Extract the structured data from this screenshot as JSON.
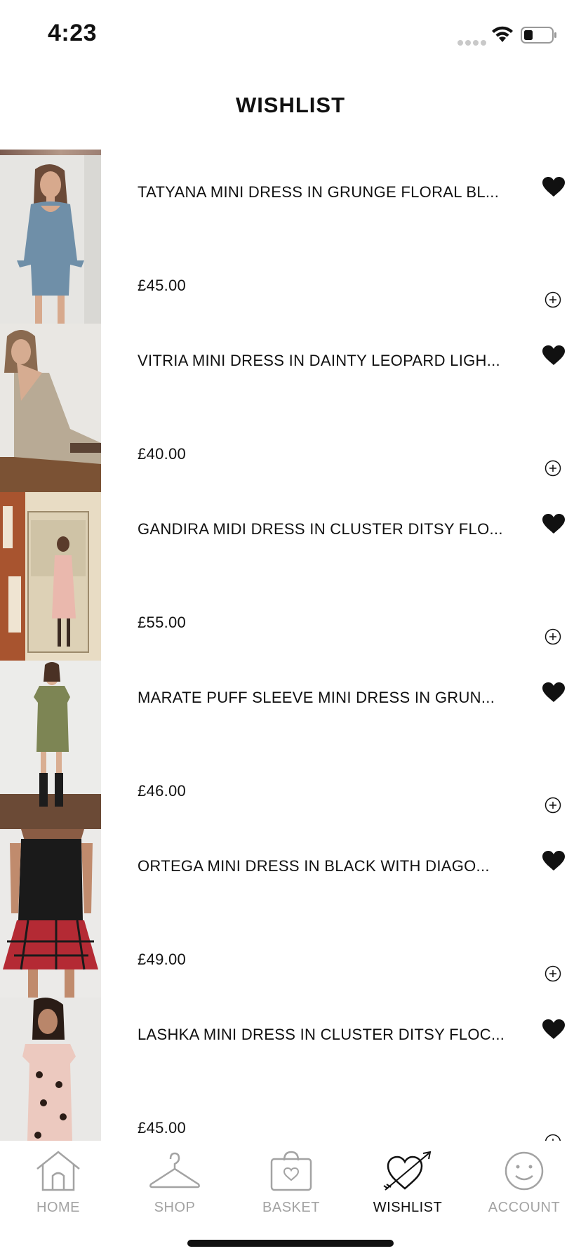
{
  "status_bar": {
    "time": "4:23",
    "signal_icon": "signal-dots-icon",
    "wifi_icon": "wifi-icon",
    "battery_icon": "battery-icon"
  },
  "header": {
    "title": "WISHLIST"
  },
  "wishlist": {
    "items": [
      {
        "name": "TATYANA MINI DRESS IN GRUNGE FLORAL BL...",
        "price": "£45.00",
        "favorited": true
      },
      {
        "name": "VITRIA MINI DRESS IN DAINTY LEOPARD LIGH...",
        "price": "£40.00",
        "favorited": true
      },
      {
        "name": "GANDIRA MIDI DRESS IN CLUSTER DITSY FLO...",
        "price": "£55.00",
        "favorited": true
      },
      {
        "name": "MARATE PUFF SLEEVE MINI DRESS IN GRUN...",
        "price": "£46.00",
        "favorited": true
      },
      {
        "name": "ORTEGA MINI DRESS IN BLACK WITH DIAGO...",
        "price": "£49.00",
        "favorited": true
      },
      {
        "name": "LASHKA MINI DRESS IN CLUSTER DITSY FLOC...",
        "price": "£45.00",
        "favorited": true
      }
    ]
  },
  "tab_bar": {
    "tabs": [
      {
        "label": "HOME",
        "icon": "home-icon",
        "active": false
      },
      {
        "label": "SHOP",
        "icon": "hanger-icon",
        "active": false
      },
      {
        "label": "BASKET",
        "icon": "basket-icon",
        "active": false
      },
      {
        "label": "WISHLIST",
        "icon": "heart-arrow-icon",
        "active": true
      },
      {
        "label": "ACCOUNT",
        "icon": "smiley-icon",
        "active": false
      }
    ]
  },
  "colors": {
    "text": "#111111",
    "inactive_tab": "#a3a3a3",
    "background": "#ffffff"
  }
}
